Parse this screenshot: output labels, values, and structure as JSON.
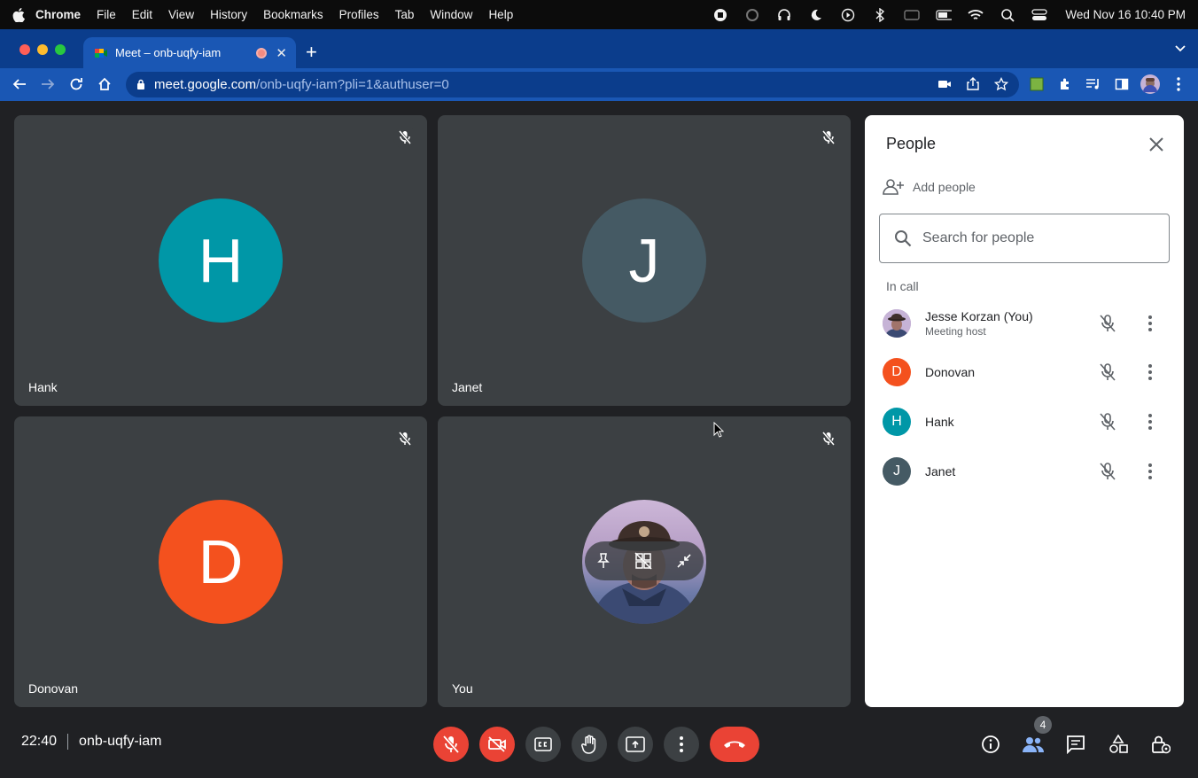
{
  "menubar": {
    "items": [
      "Chrome",
      "File",
      "Edit",
      "View",
      "History",
      "Bookmarks",
      "Profiles",
      "Tab",
      "Window",
      "Help"
    ],
    "clock": "Wed Nov 16  10:40 PM"
  },
  "browser": {
    "tab_title": "Meet – onb-uqfy-iam",
    "url_host": "meet.google.com",
    "url_path": "/onb-uqfy-iam?pli=1&authuser=0"
  },
  "tiles": [
    {
      "name": "Hank",
      "initial": "H",
      "color": "#0097a7"
    },
    {
      "name": "Janet",
      "initial": "J",
      "color": "#455a64"
    },
    {
      "name": "Donovan",
      "initial": "D",
      "color": "#f4511e"
    },
    {
      "name": "You",
      "initial": "",
      "color": "#7e8fb8"
    }
  ],
  "panel": {
    "title": "People",
    "add_label": "Add people",
    "search_placeholder": "Search for people",
    "section_label": "In call",
    "people": [
      {
        "name": "Jesse Korzan (You)",
        "role": "Meeting host",
        "initial": "",
        "color": "#b9a6c9"
      },
      {
        "name": "Donovan",
        "role": "",
        "initial": "D",
        "color": "#f4511e"
      },
      {
        "name": "Hank",
        "role": "",
        "initial": "H",
        "color": "#0097a7"
      },
      {
        "name": "Janet",
        "role": "",
        "initial": "J",
        "color": "#455a64"
      }
    ]
  },
  "meeting": {
    "time": "22:40",
    "code": "onb-uqfy-iam",
    "participant_count": "4"
  },
  "colors": {
    "accent_blue": "#8ab4f8",
    "danger_red": "#ea4335",
    "tile_bg": "#3c4043"
  }
}
